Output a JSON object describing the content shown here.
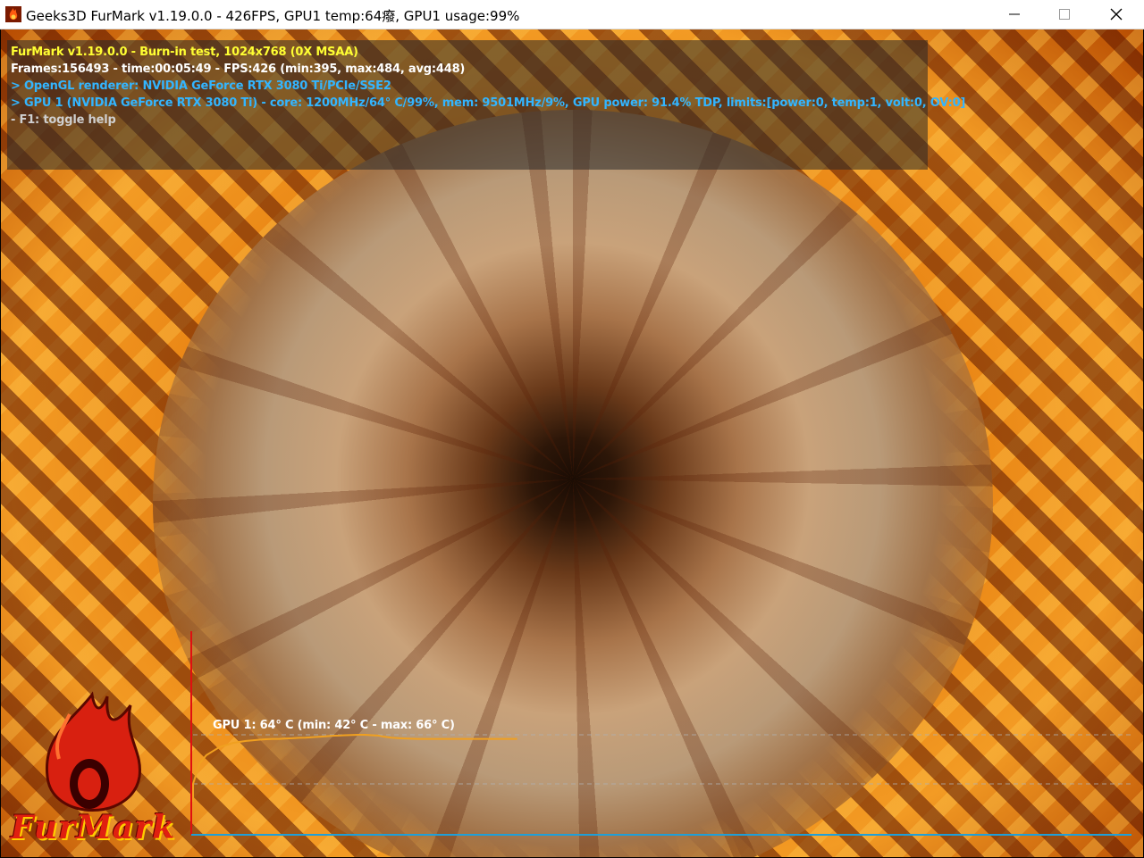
{
  "window": {
    "title": "Geeks3D FurMark v1.19.0.0 - 426FPS, GPU1 temp:64癈, GPU1 usage:99%",
    "icon": "furmark-app-icon",
    "controls": [
      "minimize-icon",
      "maximize-icon",
      "close-icon"
    ]
  },
  "overlay": {
    "line1": "FurMark v1.19.0.0 - Burn-in test, 1024x768 (0X MSAA)",
    "line2": "Frames:156493 - time:00:05:49 - FPS:426 (min:395, max:484, avg:448)",
    "line3": "> OpenGL renderer: NVIDIA GeForce RTX 3080 Ti/PCIe/SSE2",
    "line4": "> GPU 1 (NVIDIA GeForce RTX 3080 Ti) - core: 1200MHz/64° C/99%, mem: 9501MHz/9%, GPU power: 91.4% TDP, limits:[power:0, temp:1, volt:0, OV:0]",
    "line5": "- F1: toggle help"
  },
  "colors": {
    "line1": "#ffff33",
    "line2": "#ffffff",
    "line3": "#33b5ff",
    "line4": "#33b5ff",
    "line5": "#cfcfcf",
    "graph_line": "#f0a020",
    "graph_axis_y": "#e01010",
    "graph_axis_x": "#1f9fd8"
  },
  "logo": {
    "text": "FurMark"
  },
  "temp_graph": {
    "label": "GPU 1: 64° C (min: 42° C - max: 66° C)",
    "gpu": "GPU 1",
    "current_c": 64,
    "min_c": 42,
    "max_c": 66,
    "curve_c": [
      42,
      52,
      56,
      58,
      60,
      61,
      62,
      62.5,
      63,
      63.3,
      63.6,
      63.8,
      64,
      64,
      64.2,
      64.3,
      64.5,
      64.6,
      64.8,
      65,
      65.2,
      65.5,
      65.6,
      65.8,
      65.9,
      66,
      66,
      65.8,
      65.6,
      65,
      64.6,
      64.4,
      64.2,
      64.1,
      64,
      64,
      64,
      64,
      64,
      64,
      64,
      64,
      64,
      64,
      64,
      64,
      64,
      64,
      64,
      64
    ]
  }
}
